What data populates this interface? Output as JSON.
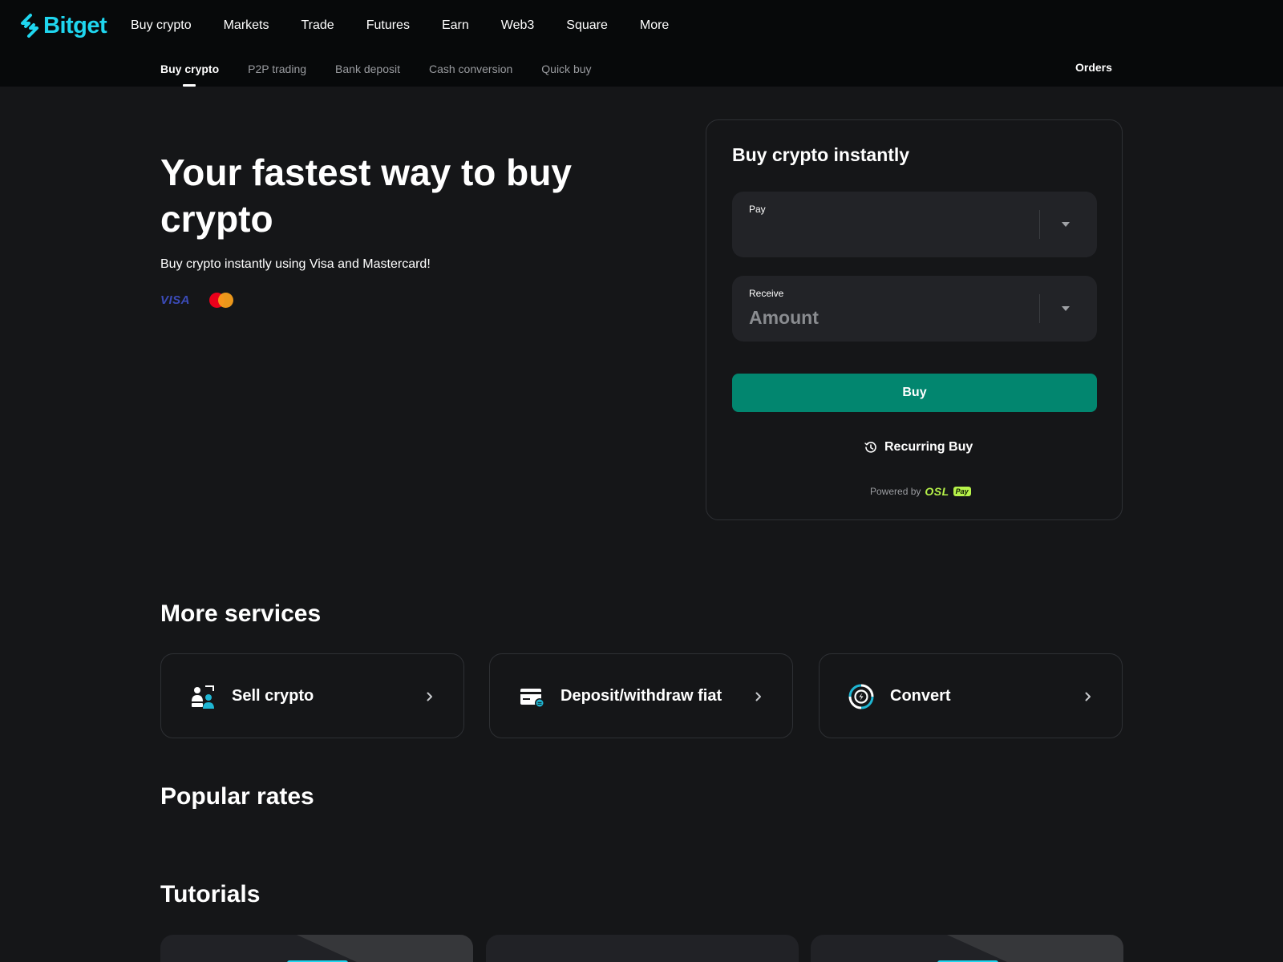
{
  "brand": {
    "name": "Bitget",
    "color": "#1fd6ef"
  },
  "main_nav": [
    "Buy crypto",
    "Markets",
    "Trade",
    "Futures",
    "Earn",
    "Web3",
    "Square",
    "More"
  ],
  "sub_nav": {
    "items": [
      "Buy crypto",
      "P2P trading",
      "Bank deposit",
      "Cash conversion",
      "Quick buy"
    ],
    "active": "Buy crypto"
  },
  "orders_label": "Orders",
  "hero": {
    "title": "Your fastest way to buy crypto",
    "subtitle": "Buy crypto instantly using Visa and Mastercard!",
    "visa_label": "VISA"
  },
  "buy_panel": {
    "title": "Buy crypto instantly",
    "pay": {
      "label": "Pay",
      "value": ""
    },
    "receive": {
      "label": "Receive",
      "placeholder": "Amount"
    },
    "buy_label": "Buy",
    "recurring_label": "Recurring Buy",
    "powered_by": "Powered by",
    "provider": "OSL",
    "provider_badge": "Pay",
    "button_color": "#02866f"
  },
  "sections": {
    "more_services": "More services",
    "popular_rates": "Popular rates",
    "tutorials": "Tutorials"
  },
  "services": [
    {
      "label": "Sell crypto",
      "icon": "sell-crypto-icon"
    },
    {
      "label": "Deposit/withdraw fiat",
      "icon": "fiat-card-icon"
    },
    {
      "label": "Convert",
      "icon": "convert-icon"
    }
  ]
}
